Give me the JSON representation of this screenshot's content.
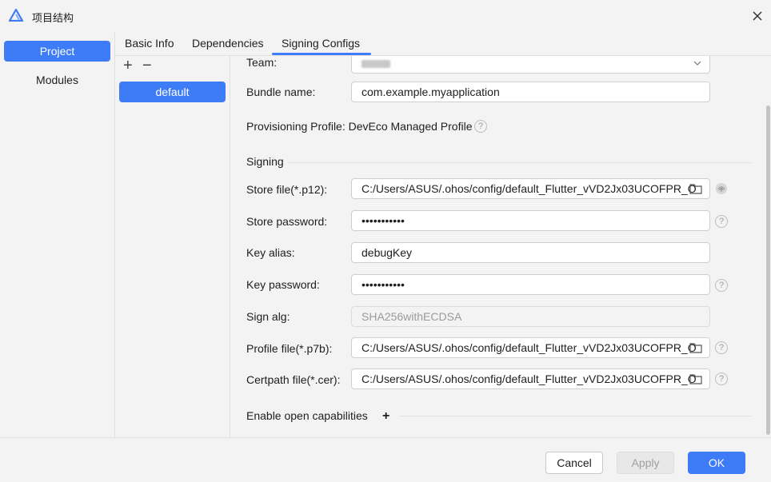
{
  "window": {
    "title": "项目结构",
    "close_icon": "close-icon"
  },
  "nav": {
    "items": [
      {
        "label": "Project",
        "active": true
      },
      {
        "label": "Modules",
        "active": false
      }
    ]
  },
  "tabs": [
    {
      "label": "Basic Info"
    },
    {
      "label": "Dependencies"
    },
    {
      "label": "Signing Configs",
      "active": true
    }
  ],
  "configs": {
    "add_label": "+",
    "remove_label": "−",
    "items": [
      "default"
    ]
  },
  "form": {
    "team_label": "Team:",
    "bundle_label": "Bundle name:",
    "bundle_value": "com.example.myapplication",
    "provisioning_label": "Provisioning Profile: DevEco Managed Profile",
    "signing_section": "Signing",
    "store_file_label": "Store file(*.p12):",
    "store_file_value": "C:/Users/ASUS/.ohos/config/default_Flutter_vVD2Jx03UCOFPR_O",
    "store_password_label": "Store password:",
    "store_password_value": "•••••••••••",
    "key_alias_label": "Key alias:",
    "key_alias_value": "debugKey",
    "key_password_label": "Key password:",
    "key_password_value": "•••••••••••",
    "sign_alg_label": "Sign alg:",
    "sign_alg_value": "SHA256withECDSA",
    "profile_file_label": "Profile file(*.p7b):",
    "profile_file_value": "C:/Users/ASUS/.ohos/config/default_Flutter_vVD2Jx03UCOFPR_O",
    "certpath_label": "Certpath file(*.cer):",
    "certpath_value": "C:/Users/ASUS/.ohos/config/default_Flutter_vVD2Jx03UCOFPR_O",
    "capabilities_label": "Enable open capabilities",
    "help_glyph": "?"
  },
  "footer": {
    "cancel_label": "Cancel",
    "apply_label": "Apply",
    "ok_label": "OK"
  },
  "colors": {
    "accent": "#3e7bf7",
    "background": "#f3f3f3"
  }
}
